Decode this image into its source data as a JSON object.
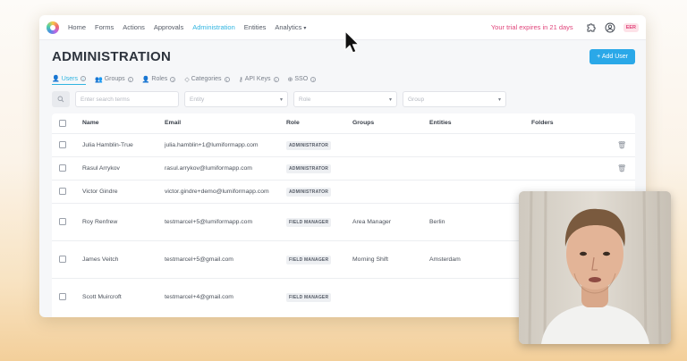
{
  "nav": {
    "items": [
      "Home",
      "Forms",
      "Actions",
      "Approvals",
      "Administration",
      "Entities",
      "Analytics"
    ],
    "active": "Administration",
    "trial": "Your trial expires in 21 days",
    "user_badge": "EER"
  },
  "page": {
    "title": "ADMINISTRATION",
    "add_user": "Add User"
  },
  "tabs": [
    {
      "label": "Users",
      "icon": "user-icon"
    },
    {
      "label": "Groups",
      "icon": "group-icon"
    },
    {
      "label": "Roles",
      "icon": "role-icon"
    },
    {
      "label": "Categories",
      "icon": "tag-icon"
    },
    {
      "label": "API Keys",
      "icon": "key-icon"
    },
    {
      "label": "SSO",
      "icon": "sso-icon"
    }
  ],
  "filters": {
    "search_placeholder": "Enter search terms",
    "entity": "Entity",
    "role": "Role",
    "group": "Group"
  },
  "table": {
    "headers": [
      "Name",
      "Email",
      "Role",
      "Groups",
      "Entities",
      "Folders"
    ],
    "rows": [
      {
        "name": "Julia Hamblin-True",
        "email": "julia.hamblin+1@lumiformapp.com",
        "role": "ADMINISTRATOR",
        "groups": "",
        "entities": "",
        "trash": true
      },
      {
        "name": "Rasul Arrykov",
        "email": "rasul.arrykov@lumiformapp.com",
        "role": "ADMINISTRATOR",
        "groups": "",
        "entities": "",
        "trash": true
      },
      {
        "name": "Victor Gindre",
        "email": "victor.gindre+demo@lumiformapp.com",
        "role": "ADMINISTRATOR",
        "groups": "",
        "entities": "",
        "trash": false
      },
      {
        "name": "Roy Renfrew",
        "email": "testmarcel+5@lumiformapp.com",
        "role": "FIELD MANAGER",
        "groups": "Area Manager",
        "entities": "Berlin",
        "trash": false
      },
      {
        "name": "James Veitch",
        "email": "testmarcel+5@gmail.com",
        "role": "FIELD MANAGER",
        "groups": "Morning Shift",
        "entities": "Amsterdam",
        "trash": false
      },
      {
        "name": "Scott Muircroft",
        "email": "testmarcel+4@gmail.com",
        "role": "FIELD MANAGER",
        "groups": "",
        "entities": "",
        "trash": false
      }
    ]
  },
  "colors": {
    "accent": "#2fb4e0",
    "button": "#2aa8e8",
    "trial": "#e0457b"
  }
}
